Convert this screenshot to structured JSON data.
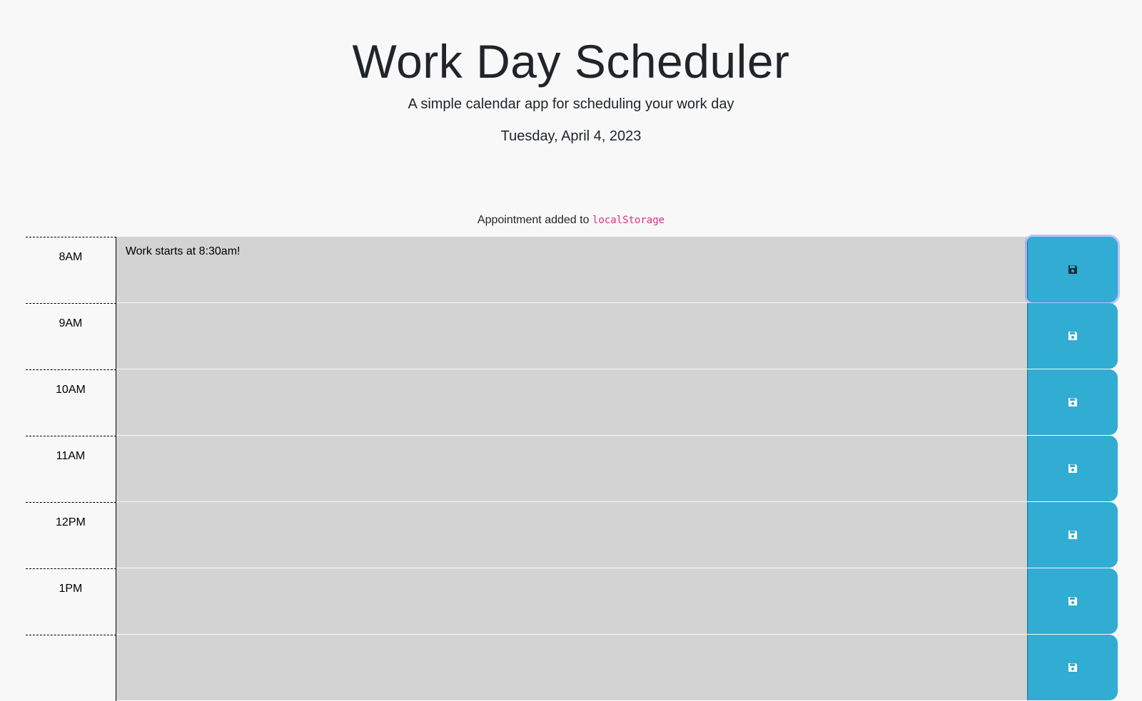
{
  "header": {
    "title": "Work Day Scheduler",
    "subtitle": "A simple calendar app for scheduling your work day",
    "current_day": "Tuesday, April 4, 2023"
  },
  "notice": {
    "text": "Appointment added to ",
    "code": "localStorage"
  },
  "colors": {
    "past_block": "#d3d3d3",
    "save_button": "#31acd3"
  },
  "save_icon": "floppy-disk-icon",
  "time_blocks": [
    {
      "hour": "8AM",
      "description": "Work starts at 8:30am!"
    },
    {
      "hour": "9AM",
      "description": ""
    },
    {
      "hour": "10AM",
      "description": ""
    },
    {
      "hour": "11AM",
      "description": ""
    },
    {
      "hour": "12PM",
      "description": ""
    },
    {
      "hour": "1PM",
      "description": ""
    },
    {
      "hour": "",
      "description": ""
    }
  ]
}
